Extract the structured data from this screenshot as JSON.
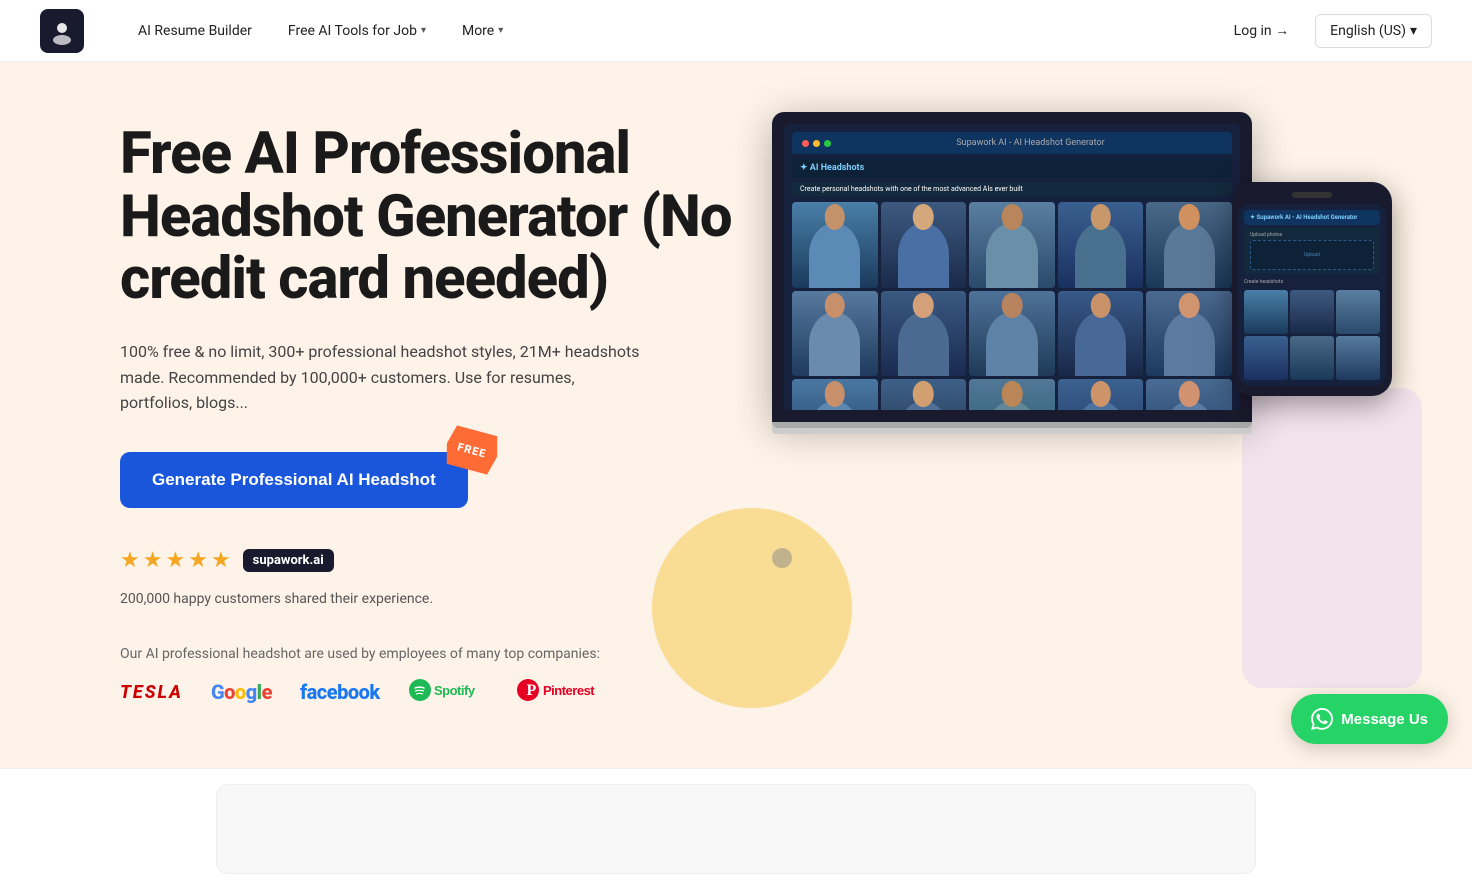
{
  "nav": {
    "logo_text": "supawork.ai",
    "links": [
      {
        "id": "ai-resume-builder",
        "label": "AI Resume Builder",
        "has_dropdown": false
      },
      {
        "id": "free-ai-tools",
        "label": "Free AI Tools for Job",
        "has_dropdown": true
      },
      {
        "id": "more",
        "label": "More",
        "has_dropdown": true
      }
    ],
    "login_label": "Log in →",
    "lang_label": "English (US)",
    "lang_has_dropdown": true
  },
  "hero": {
    "title": "Free AI Professional Headshot Generator (No credit card needed)",
    "subtitle": "100% free & no limit, 300+ professional headshot styles, 21M+ headshots made. Recommended by 100,000+ customers. Use for resumes, portfolios, blogs...",
    "cta_button": "Generate Professional AI Headshot",
    "free_badge": "FREE",
    "review_count": "200,000",
    "review_text": "200,000 happy customers shared their experience.",
    "company_label": "Our AI professional headshot are used by employees of many top companies:",
    "companies": [
      "TESLA",
      "Google",
      "facebook",
      "spotify",
      "Pinterest"
    ]
  },
  "message_button": {
    "label": "Message Us"
  },
  "laptop_mockup": {
    "title": "Supawork AI - AI Headshot Generator",
    "app_title": "AI Headshots",
    "app_subtitle": "Create personal headshots with one of the most advanced AIs ever built"
  },
  "phone_mockup": {
    "title": "Supawork AI - AI Headshot Generator",
    "upload_label": "Upload photos",
    "upload_cta": "Upload",
    "create_label": "Create headshots"
  }
}
